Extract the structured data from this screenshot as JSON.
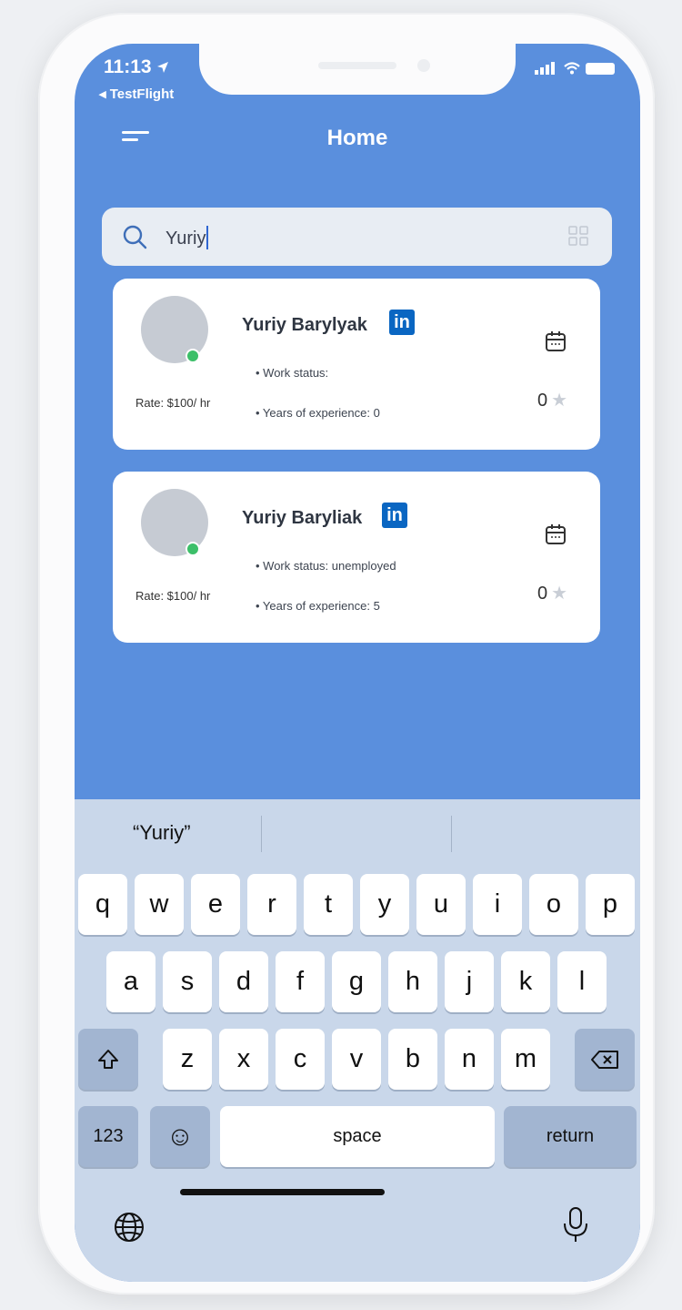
{
  "status_bar": {
    "time": "11:13",
    "back_label": "◂ TestFlight"
  },
  "header": {
    "title": "Home"
  },
  "search": {
    "value": "Yuriy"
  },
  "results": [
    {
      "name": "Yuriy Barylyak",
      "work_status": "• Work status:",
      "experience": "• Years of experience: 0",
      "rate": "Rate: $100/ hr",
      "rating": "0"
    },
    {
      "name": "Yuriy Baryliak",
      "work_status": "• Work status: unemployed",
      "experience": "• Years of experience: 5",
      "rate": "Rate: $100/ hr",
      "rating": "0"
    }
  ],
  "keyboard": {
    "suggestion": "“Yuriy”",
    "row1": [
      "q",
      "w",
      "e",
      "r",
      "t",
      "y",
      "u",
      "i",
      "o",
      "p"
    ],
    "row2": [
      "a",
      "s",
      "d",
      "f",
      "g",
      "h",
      "j",
      "k",
      "l"
    ],
    "row3": [
      "z",
      "x",
      "c",
      "v",
      "b",
      "n",
      "m"
    ],
    "numbers_label": "123",
    "space_label": "space",
    "return_label": "return"
  },
  "icons": {
    "linkedin": "in",
    "star": "★",
    "emoji": "☺"
  },
  "colors": {
    "background": "#5a8fdd",
    "online": "#3cbf69",
    "linkedin": "#0a66c2"
  }
}
